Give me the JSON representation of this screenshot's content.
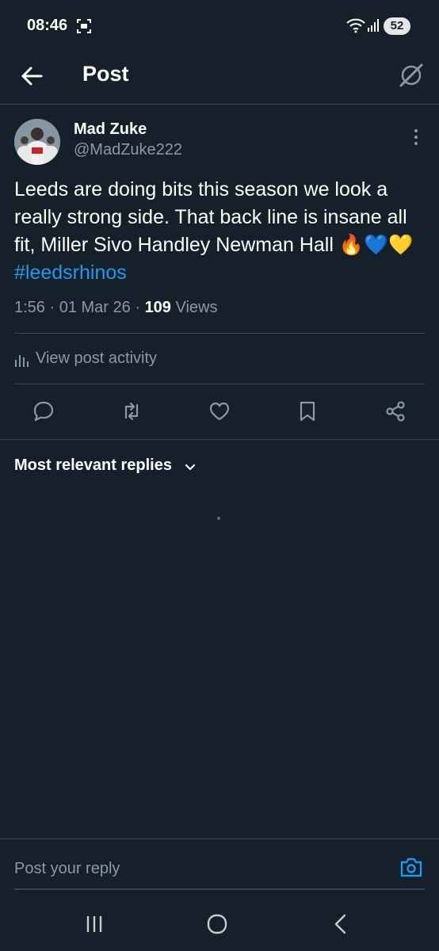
{
  "status_bar": {
    "time": "08:46",
    "battery": "52",
    "icons": [
      "screenshot-icon",
      "wifi-icon",
      "signal-icon"
    ]
  },
  "header": {
    "title": "Post",
    "back_icon": "arrow-left-icon",
    "grok_icon": "grok-icon"
  },
  "post": {
    "author_name": "Mad Zuke",
    "author_handle": "@MadZuke222",
    "text": "Leeds are doing bits this season we look a really strong side. That back line is insane all fit, Miller Sivo Handley Newman Hall 🔥💙💛",
    "hashtag": "#leedsrhinos",
    "time": "1:56",
    "date": "01 Mar 26",
    "views_count": "109",
    "views_label": "Views",
    "activity_label": "View post activity"
  },
  "actions": [
    "reply-icon",
    "repost-icon",
    "like-icon",
    "bookmark-icon",
    "share-icon"
  ],
  "replies": {
    "sort_label": "Most relevant replies"
  },
  "composer": {
    "placeholder": "Post your reply"
  },
  "colors": {
    "background": "#15202b",
    "accent": "#1d9bf0",
    "secondary_text": "#8b98a5",
    "border": "#38444d"
  }
}
